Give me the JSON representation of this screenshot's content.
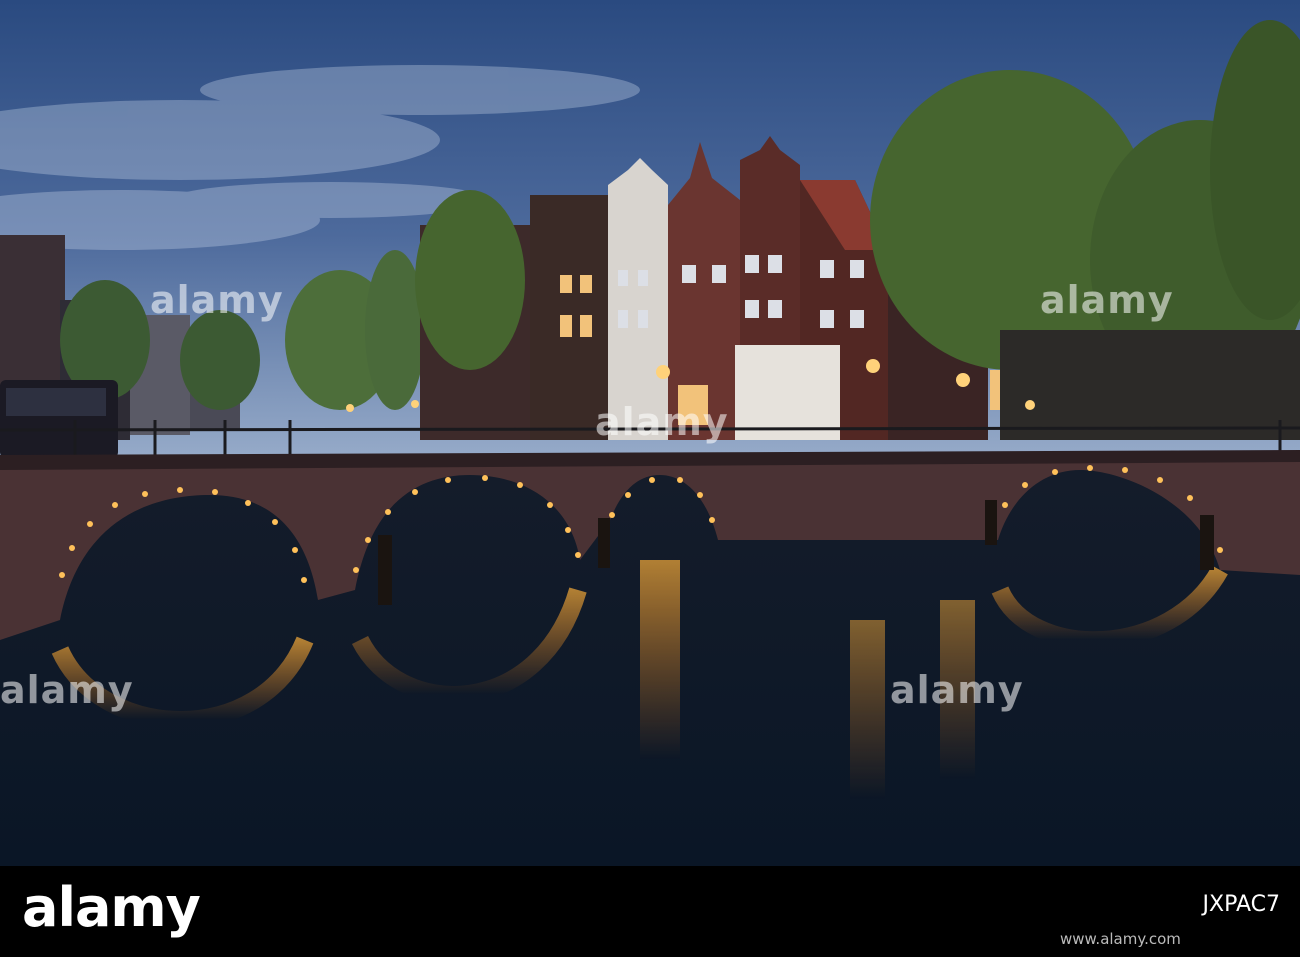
{
  "photo": {
    "subject": "Amsterdam canal bridge at dusk",
    "colors": {
      "sky_top": "#2c4f86",
      "sky_bottom": "#8aa3c6",
      "water": "#0c1422",
      "brick": "#4a3234",
      "lights": "#ffb13a"
    }
  },
  "watermark": {
    "text": "alamy"
  },
  "footer": {
    "brand": "alamy",
    "image_id": "JXPAC7",
    "url": "www.alamy.com"
  }
}
